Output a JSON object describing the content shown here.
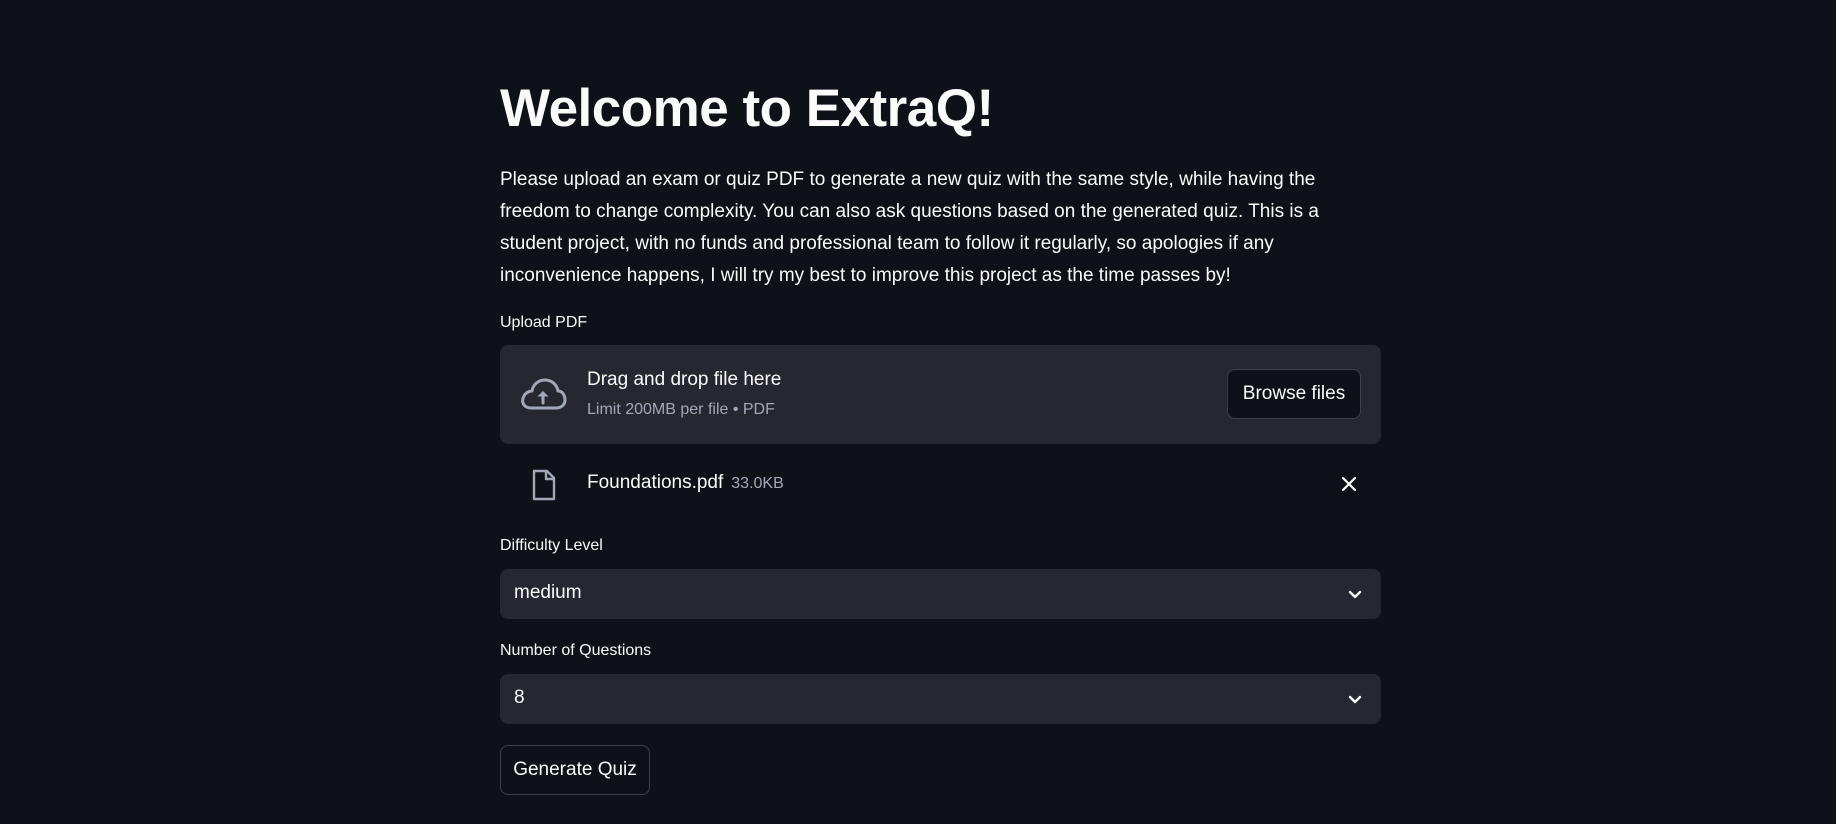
{
  "page": {
    "title": "Welcome to ExtraQ!",
    "intro": "Please upload an exam or quiz PDF to generate a new quiz with the same style, while having the freedom to change complexity. You can also ask questions based on the generated quiz. This is a student project, with no funds and professional team to follow it regularly, so apologies if any inconvenience happens, I will try my best to improve this project as the time passes by!"
  },
  "uploader": {
    "label": "Upload PDF",
    "drop_title": "Drag and drop file here",
    "drop_subtitle": "Limit 200MB per file • PDF",
    "browse_label": "Browse files",
    "icon": "cloud-upload-icon"
  },
  "uploaded_file": {
    "name": "Foundations.pdf",
    "size": "33.0KB",
    "icon": "file-icon",
    "remove_icon": "close-icon"
  },
  "difficulty": {
    "label": "Difficulty Level",
    "value": "medium"
  },
  "num_questions": {
    "label": "Number of Questions",
    "value": "8"
  },
  "actions": {
    "generate_label": "Generate Quiz"
  },
  "colors": {
    "background": "#0e1117",
    "widget_background": "#262730",
    "text": "#fafafa",
    "muted_text": "#a3a8b8",
    "border": "#3d404b"
  }
}
